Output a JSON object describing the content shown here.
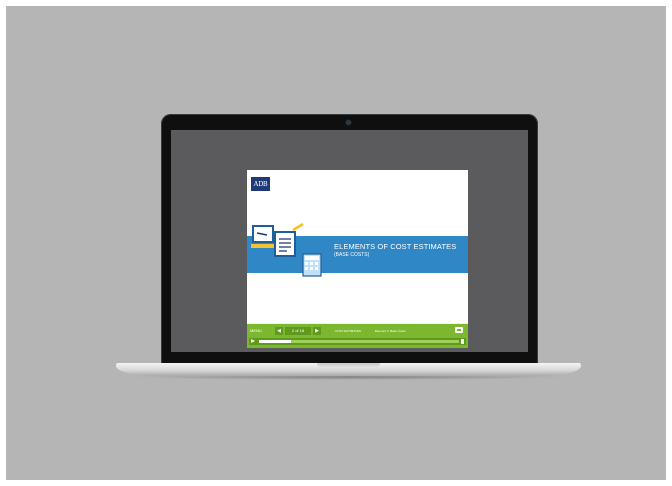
{
  "slide": {
    "logo": "ADB",
    "title": "ELEMENTS OF COST ESTIMATES",
    "subtitle": "(BASE COSTS)"
  },
  "player": {
    "menu_label": "MENU",
    "prev_icon": "chevron-left-icon",
    "next_icon": "chevron-right-icon",
    "page_count": "2 of 18",
    "topic": "COST ESTIMATES",
    "section": "Element 1: Base Costs",
    "progress": 0.16,
    "colors": {
      "bar": "#7cb82f",
      "button": "#5f9a1f",
      "banner": "#2f87c6",
      "logo": "#1f3a78"
    }
  }
}
